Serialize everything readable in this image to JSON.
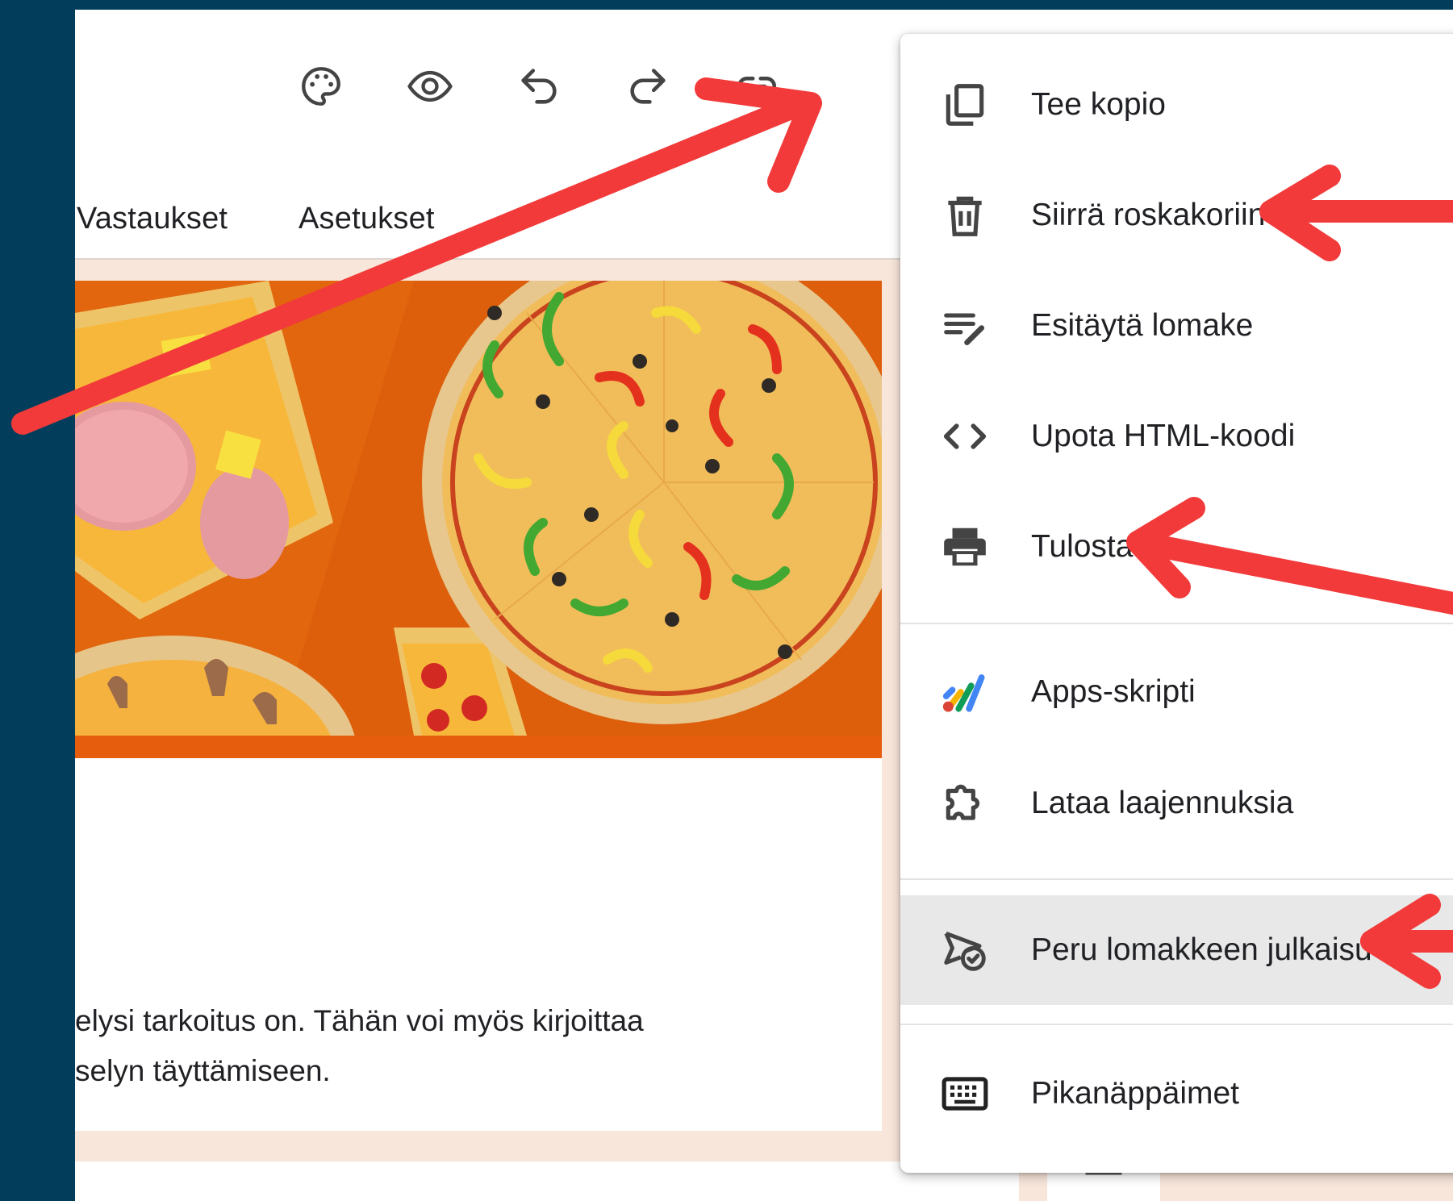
{
  "tabs": {
    "responses": "Vastaukset",
    "settings": "Asetukset"
  },
  "toolbar": {
    "icons": [
      "palette-icon",
      "eye-icon",
      "undo-icon",
      "redo-icon",
      "link-icon"
    ]
  },
  "description": {
    "line1": "elysi tarkoitus on. Tähän voi myös kirjoittaa",
    "line2": "selyn täyttämiseen."
  },
  "menu": {
    "items": [
      {
        "label": "Tee kopio",
        "icon": "copy-icon"
      },
      {
        "label": "Siirrä roskakoriin",
        "icon": "trash-icon"
      },
      {
        "label": "Esitäytä lomake",
        "icon": "prefill-icon"
      },
      {
        "label": "Upota HTML-koodi",
        "icon": "code-icon"
      },
      {
        "label": "Tulosta",
        "icon": "print-icon"
      },
      {
        "label": "Apps-skripti",
        "icon": "apps-script-icon"
      },
      {
        "label": "Lataa laajennuksia",
        "icon": "puzzle-icon"
      },
      {
        "label": "Peru lomakkeen julkaisu",
        "icon": "unpublish-icon"
      },
      {
        "label": "Pikanäppäimet",
        "icon": "keyboard-icon"
      }
    ],
    "highlighted": "Peru lomakkeen julkaisu"
  },
  "colors": {
    "page_background": "#023e5c",
    "form_background": "#f8e6da",
    "header_accent": "#e55d0d",
    "avatar": "#5b2fbd",
    "annotation_arrow": "#f23a3a",
    "menu_highlight": "#e8e8e8"
  }
}
